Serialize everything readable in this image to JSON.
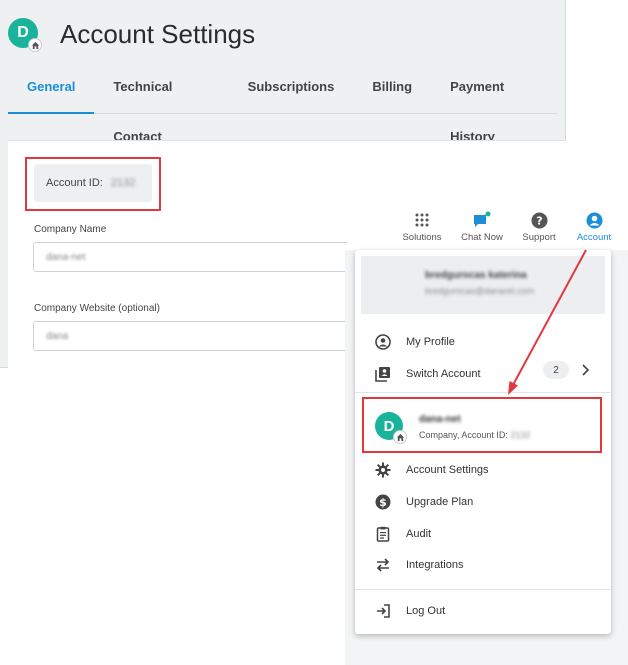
{
  "header": {
    "avatar_letter": "D",
    "title": "Account Settings"
  },
  "tabs": [
    {
      "label": "General",
      "active": true
    },
    {
      "label": "Technical Contact"
    },
    {
      "label": "Subscriptions"
    },
    {
      "label": "Billing"
    },
    {
      "label": "Payment History"
    }
  ],
  "general": {
    "account_id_label": "Account ID:",
    "account_id_value": "2132",
    "company_name_label": "Company Name",
    "company_name_value": "dana-net",
    "company_website_label": "Company Website (optional)",
    "company_website_value": "dana"
  },
  "topbar": {
    "solutions": "Solutions",
    "chat_now": "Chat Now",
    "support": "Support",
    "account": "Account"
  },
  "menu": {
    "user_name": "bredgurocas katerina",
    "user_email": "bredgurocas@danaret.com",
    "my_profile": "My Profile",
    "switch_account": "Switch Account",
    "switch_count": "2",
    "current_account_letter": "D",
    "current_account_name": "dana-net",
    "current_account_sub": "Company, Account ID:",
    "current_account_id": "2132",
    "account_settings": "Account Settings",
    "upgrade_plan": "Upgrade Plan",
    "audit": "Audit",
    "integrations": "Integrations",
    "log_out": "Log Out"
  },
  "colors": {
    "accent": "#1a8fd6",
    "avatar": "#19b39b",
    "highlight": "#e0383e"
  }
}
